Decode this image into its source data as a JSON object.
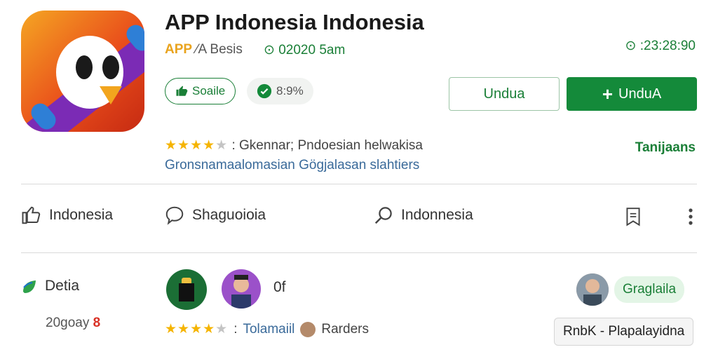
{
  "app": {
    "title": "APP Indonesia Indonesia",
    "developer_brand": "APP",
    "developer_sub": "⁄A Besis",
    "stamp": "02020 5am",
    "timer": ":23:28:90"
  },
  "chips": {
    "like_label": "Soaile",
    "rating_label": "8:9%"
  },
  "buttons": {
    "secondary_label": "Undua",
    "primary_label": "UnduA"
  },
  "summary": {
    "stars": 4,
    "rating_text": ": Gkennar; Pndoesian helwakisa",
    "description": "Gronsnamaalomasian Gögjalasan slahtiers",
    "tag": "Tanijaans"
  },
  "actions": {
    "like_label": "Indonesia",
    "comment_label": "Shaguoioia",
    "search_label": "Indonnesia",
    "bookmark_icon": "bookmark-icon",
    "more_icon": "more-vert-icon"
  },
  "details": {
    "label": "Detia",
    "sub_value": "20goay",
    "sub_badge": "8",
    "of_label": "0f",
    "review_stars": 4,
    "review_link": "Tolamaiil",
    "review_author": "Rarders",
    "pill": "Graglaila",
    "tooltip": "RnbK - Plapalayidna"
  },
  "colors": {
    "primary_green": "#148a3a",
    "accent_text_green": "#1a7f37",
    "star_gold": "#f5b400",
    "brand_orange": "#e9a31d"
  }
}
